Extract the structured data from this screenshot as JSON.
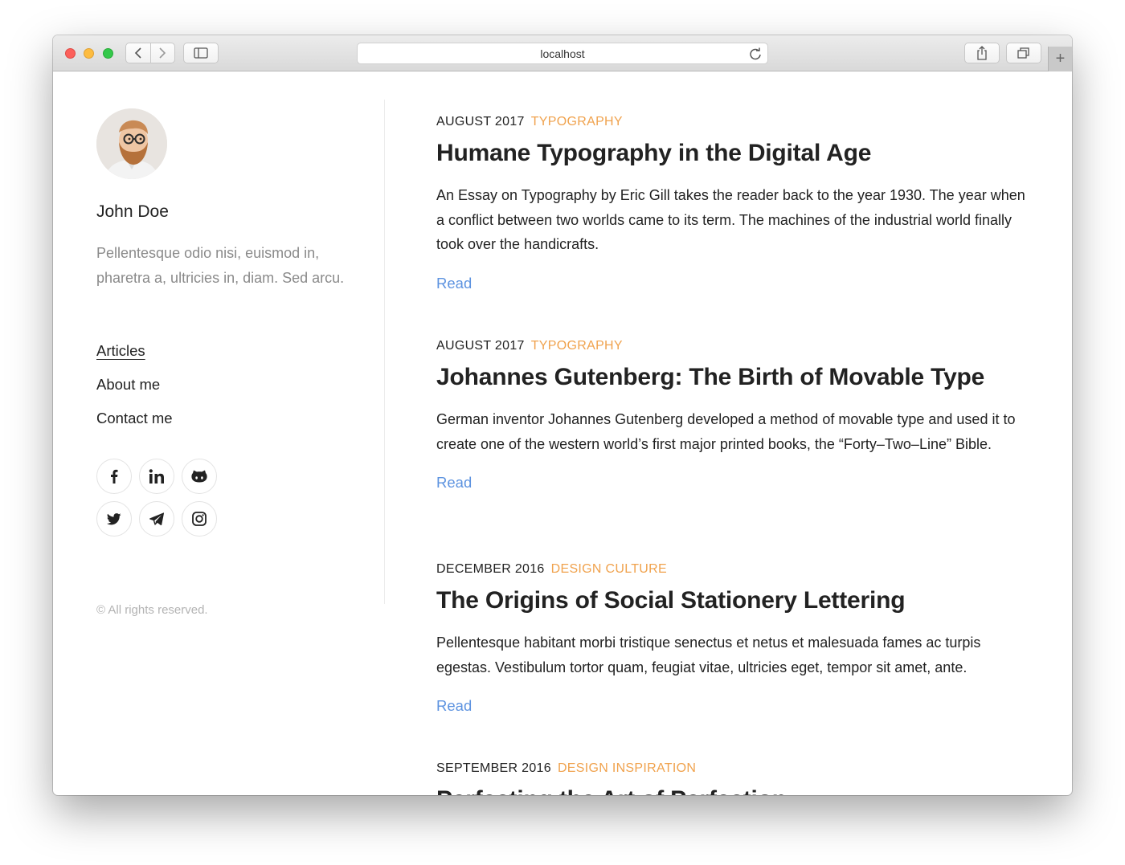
{
  "browser": {
    "address": "localhost",
    "new_tab": "+"
  },
  "sidebar": {
    "author": "John Doe",
    "bio": "Pellentesque odio nisi, euismod in, pharetra a, ultricies in, diam. Sed arcu.",
    "menu": [
      {
        "label": "Articles",
        "active": true
      },
      {
        "label": "About me",
        "active": false
      },
      {
        "label": "Contact me",
        "active": false
      }
    ],
    "social": [
      "facebook-icon",
      "linkedin-icon",
      "github-icon",
      "twitter-icon",
      "telegram-icon",
      "instagram-icon"
    ],
    "copyright": "© All rights reserved."
  },
  "posts": [
    {
      "date": "AUGUST 2017",
      "category": "TYPOGRAPHY",
      "title": "Humane Typography in the Digital Age",
      "excerpt": "An Essay on Typography by Eric Gill takes the reader back to the year 1930. The year when a conflict between two worlds came to its term. The machines of the industrial world finally took over the handicrafts.",
      "read": "Read"
    },
    {
      "date": "AUGUST 2017",
      "category": "TYPOGRAPHY",
      "title": "Johannes Gutenberg: The Birth of Movable Type",
      "excerpt": "German inventor Johannes Gutenberg developed a method of movable type and used it to create one of the western world’s first major printed books, the “Forty–Two–Line” Bible.",
      "read": "Read"
    },
    {
      "date": "DECEMBER 2016",
      "category": "DESIGN CULTURE",
      "title": "The Origins of Social Stationery Lettering",
      "excerpt": "Pellentesque habitant morbi tristique senectus et netus et malesuada fames ac turpis egestas. Vestibulum tortor quam, feugiat vitae, ultricies eget, tempor sit amet, ante.",
      "read": "Read"
    },
    {
      "date": "SEPTEMBER 2016",
      "category": "DESIGN INSPIRATION",
      "title": "Perfecting the Art of Perfection"
    }
  ],
  "colors": {
    "category": "#f0a24d",
    "link": "#5d93e0",
    "muted": "#8a8a8a"
  }
}
